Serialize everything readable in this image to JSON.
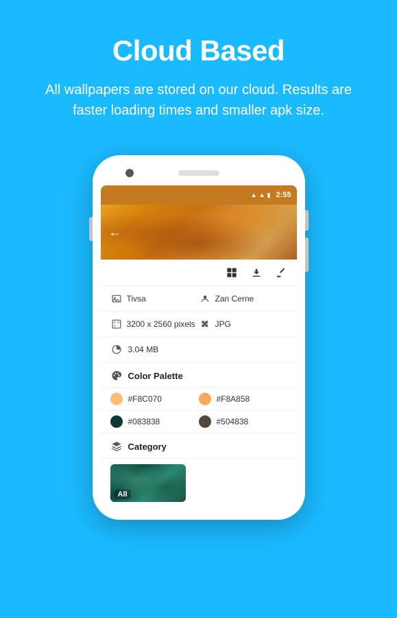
{
  "page": {
    "background_color": "#1ABAFF",
    "title": "Cloud Based",
    "subtitle": "All wallpapers are stored on our cloud. Results are faster loading times and smaller apk size.",
    "status_bar": {
      "time": "2:55",
      "icons": [
        "wifi",
        "signal",
        "battery"
      ]
    },
    "toolbar": {
      "icons": [
        "grid",
        "download",
        "brush"
      ]
    },
    "info_rows": [
      {
        "col1": {
          "icon": "image",
          "text": "Tivsa"
        },
        "col2": {
          "icon": "person",
          "text": "Zan Cerne"
        }
      },
      {
        "col1": {
          "icon": "dimensions",
          "text": "3200 x 2560 pixels"
        },
        "col2": {
          "icon": "puzzle",
          "text": "JPG"
        }
      },
      {
        "col1": {
          "icon": "pie",
          "text": "3.04 MB"
        },
        "col2": null
      }
    ],
    "color_palette": {
      "label": "Color Palette",
      "colors": [
        {
          "hex": "#F8C070",
          "display": "#F8C070"
        },
        {
          "hex": "#F8A858",
          "display": "#F8A858"
        },
        {
          "hex": "#083838",
          "display": "#083838"
        },
        {
          "hex": "#504838",
          "display": "#504838"
        }
      ]
    },
    "category": {
      "label": "Category",
      "items": [
        {
          "label": "All"
        }
      ]
    }
  }
}
